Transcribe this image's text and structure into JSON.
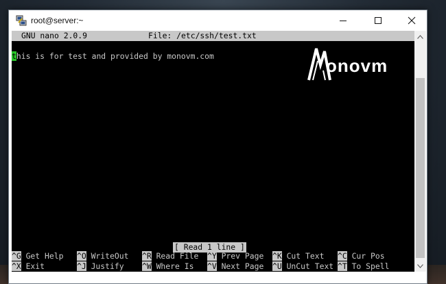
{
  "window": {
    "title": "root@server:~"
  },
  "nano": {
    "version": "GNU nano 2.0.9",
    "file": "File: /etc/ssh/test.txt",
    "cursor_char": "t",
    "content_rest": "his is for test and provided by monovm.com",
    "status": "[ Read 1 line ]",
    "shortcuts": [
      {
        "key": "^G",
        "label": "Get Help"
      },
      {
        "key": "^O",
        "label": "WriteOut"
      },
      {
        "key": "^R",
        "label": "Read File"
      },
      {
        "key": "^Y",
        "label": "Prev Page"
      },
      {
        "key": "^K",
        "label": "Cut Text"
      },
      {
        "key": "^C",
        "label": "Cur Pos"
      },
      {
        "key": "^X",
        "label": "Exit"
      },
      {
        "key": "^J",
        "label": "Justify"
      },
      {
        "key": "^W",
        "label": "Where Is"
      },
      {
        "key": "^V",
        "label": "Next Page"
      },
      {
        "key": "^U",
        "label": "UnCut Text"
      },
      {
        "key": "^T",
        "label": "To Spell"
      }
    ]
  },
  "logo": {
    "text": "onovm",
    "mark": "M"
  },
  "colors": {
    "terminal_bg": "#000000",
    "terminal_fg": "#c8c8c8",
    "cursor": "#27c427"
  },
  "icons": {
    "app": "putty-icon",
    "minimize": "minimize-icon",
    "maximize": "maximize-icon",
    "close": "close-icon"
  }
}
